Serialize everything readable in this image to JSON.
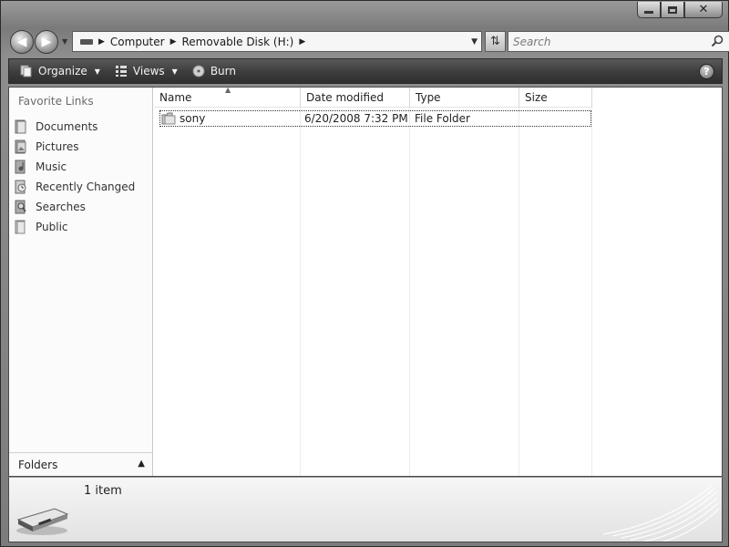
{
  "window": {
    "caption": {
      "minimize": "minimize",
      "maximize": "maximize",
      "close": "✕"
    }
  },
  "address": {
    "crumbs": [
      "Computer",
      "Removable Disk (H:)"
    ]
  },
  "search": {
    "placeholder": "Search"
  },
  "toolbar": {
    "organize": "Organize",
    "views": "Views",
    "burn": "Burn",
    "help": "?"
  },
  "nav": {
    "favorite_title": "Favorite Links",
    "items": [
      {
        "label": "Documents",
        "icon": "documents-icon"
      },
      {
        "label": "Pictures",
        "icon": "pictures-icon"
      },
      {
        "label": "Music",
        "icon": "music-icon"
      },
      {
        "label": "Recently Changed",
        "icon": "recently-changed-icon"
      },
      {
        "label": "Searches",
        "icon": "searches-icon"
      },
      {
        "label": "Public",
        "icon": "public-icon"
      }
    ],
    "folders_label": "Folders"
  },
  "columns": [
    "Name",
    "Date modified",
    "Type",
    "Size"
  ],
  "files": [
    {
      "name": "sony",
      "date": "6/20/2008 7:32 PM",
      "type": "File Folder",
      "size": ""
    }
  ],
  "details": {
    "count": "1 item"
  }
}
